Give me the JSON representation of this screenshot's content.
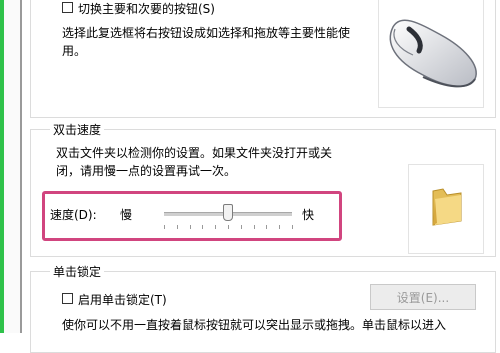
{
  "buttons_section": {
    "switch_buttons_label": "切换主要和次要的按钮(S)",
    "switch_buttons_desc": "选择此复选框将右按钮设成如选择和拖放等主要性能使用。"
  },
  "double_click": {
    "legend": "双击速度",
    "desc": "双击文件夹以检测你的设置。如果文件夹没打开或关闭，请用慢一点的设置再试一次。",
    "speed_label": "速度(D):",
    "slow_label": "慢",
    "fast_label": "快",
    "speed_level": 0.5
  },
  "click_lock": {
    "legend": "单击锁定",
    "enable_label": "启用单击锁定(T)",
    "settings_button": "设置(E)...",
    "desc": "使你可以不用一直按着鼠标按钮就可以突出显示或拖拽。单击鼠标以进入"
  },
  "colors": {
    "accent_highlight": "#d1457f",
    "side_strip": "#2fc24a"
  }
}
